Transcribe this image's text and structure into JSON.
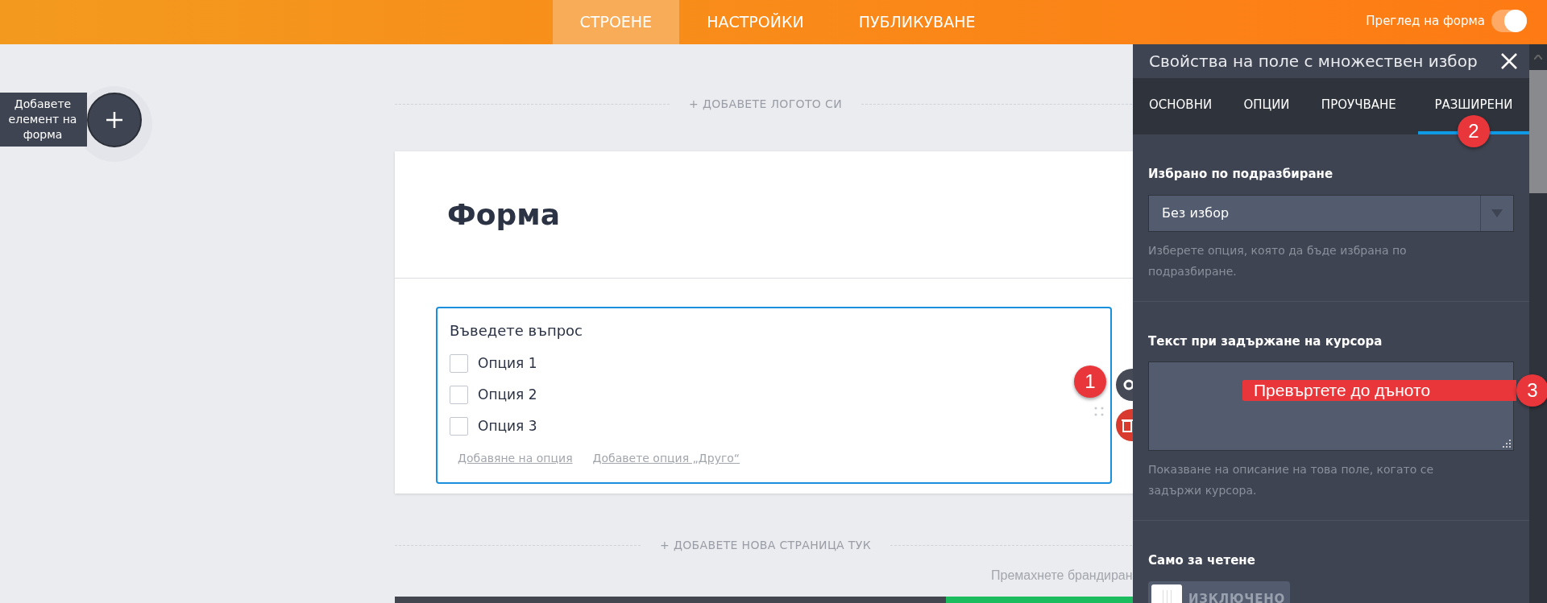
{
  "top_bar": {
    "tabs": [
      {
        "label": "СТРОЕНЕ",
        "selected": true
      },
      {
        "label": "НАСТРОЙКИ",
        "selected": false
      },
      {
        "label": "ПУБЛИКУВАНЕ",
        "selected": false
      }
    ],
    "preview_label": "Преглед на форма",
    "preview_on": true
  },
  "add_element": {
    "label": "Добавете елемент на форма"
  },
  "canvas": {
    "add_logo": "+ ДОБАВЕТЕ ЛОГОТО СИ",
    "form_title": "Форма",
    "question": {
      "label": "Въведете въпрос",
      "options": [
        {
          "label": "Опция 1",
          "checked": false
        },
        {
          "label": "Опция 2",
          "checked": false
        },
        {
          "label": "Опция 3",
          "checked": false
        }
      ],
      "links": [
        "Добавяне на опция",
        "Добавете опция „Друго“"
      ],
      "badge": "1"
    },
    "add_page": "+ ДОБАВЕТЕ НОВА СТРАНИЦА ТУК",
    "branding": "Премахнете брандиран"
  },
  "panel": {
    "title": "Свойства на поле с множествен избор",
    "tabs": [
      {
        "label": "ОСНОВНИ",
        "selected": false
      },
      {
        "label": "ОПЦИИ",
        "selected": false
      },
      {
        "label": "ПРОУЧВАНЕ",
        "selected": false
      },
      {
        "label": "РАЗШИРЕНИ",
        "selected": true
      }
    ],
    "tab_badge": "2",
    "sections": [
      {
        "kind": "select",
        "title": "Избрано по подразбиране",
        "value": "Без избор",
        "help": "Изберете опция, която да бъде избрана по подразбиране."
      },
      {
        "kind": "textarea",
        "title": "Текст при задържане на курсора",
        "help": "Показване на описание на това поле, когато се задържи курсора.",
        "callout": "Превъртете до дъното",
        "badge": "3"
      },
      {
        "kind": "toggle",
        "title": "Само за четене",
        "on": false,
        "off_label": "ИЗКЛЮЧЕНО"
      }
    ]
  }
}
